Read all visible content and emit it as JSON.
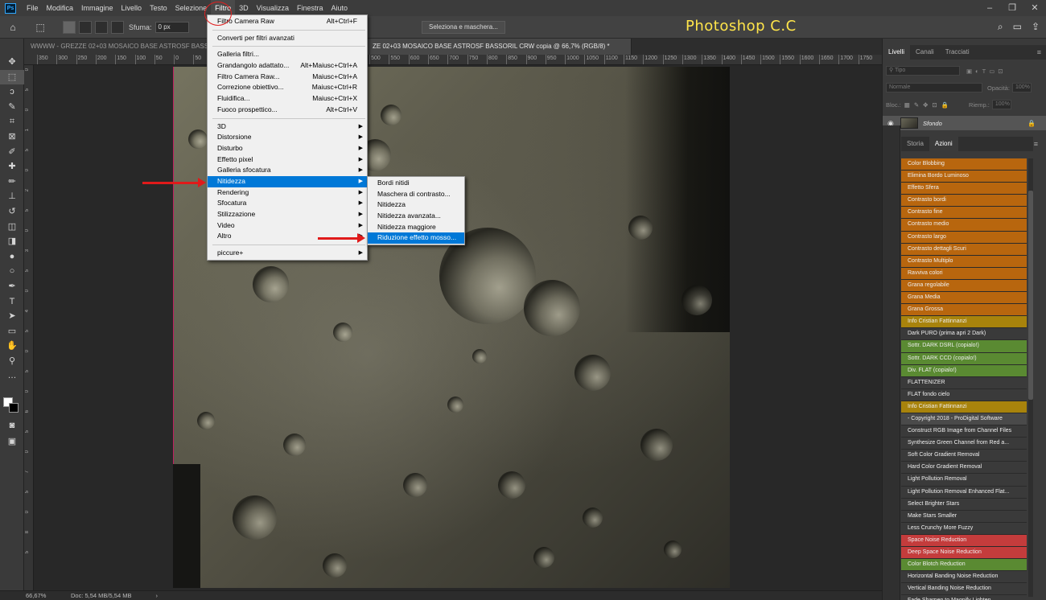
{
  "app": {
    "logo": "Ps",
    "brand_text": "Photoshop C.C"
  },
  "menubar": {
    "items": [
      "File",
      "Modifica",
      "Immagine",
      "Livello",
      "Testo",
      "Selezione",
      "Filtro",
      "3D",
      "Visualizza",
      "Finestra",
      "Aiuto"
    ],
    "active": "Filtro",
    "window_controls": [
      "–",
      "❐",
      "✕"
    ]
  },
  "options_bar": {
    "home_icon": "home-icon",
    "feather_label": "Sfuma:",
    "feather_value": "0 px",
    "select_mask_label": "Seleziona e maschera...",
    "right_icons": [
      "search-icon",
      "workspace-icon",
      "share-icon"
    ]
  },
  "tabs": [
    {
      "label": "WWWW - GREZZE 02+03 MOSAICO BASE ASTROSF BASSORIL",
      "active": false
    },
    {
      "label": "ZE 02+03 MOSAICO BASE ASTROSF BASSORIL CRW copia @ 66,7% (RGB/8) *",
      "active": true
    }
  ],
  "ruler": {
    "top_ticks": [
      "350",
      "300",
      "250",
      "200",
      "150",
      "100",
      "50",
      "0",
      "50",
      "100",
      "150",
      "200",
      "250",
      "300",
      "350",
      "400",
      "450",
      "500",
      "550",
      "600",
      "650",
      "700",
      "750",
      "800",
      "850",
      "900",
      "950",
      "1000",
      "1050",
      "1100",
      "1150",
      "1200",
      "1250",
      "1300",
      "1350",
      "1400",
      "1450",
      "1500",
      "1550",
      "1600",
      "1650",
      "1700",
      "1750"
    ],
    "left_ticks": [
      "0",
      "5",
      "0",
      "1",
      "5",
      "0",
      "2",
      "5",
      "0",
      "3",
      "5",
      "0",
      "4",
      "5",
      "0",
      "5",
      "0",
      "6",
      "5",
      "0",
      "7",
      "5",
      "0",
      "8",
      "5"
    ]
  },
  "filtro_menu": {
    "items": [
      {
        "label": "Filtro Camera Raw",
        "shortcut": "Alt+Ctrl+F"
      },
      {
        "sep": true
      },
      {
        "label": "Converti per filtri avanzati"
      },
      {
        "sep": true
      },
      {
        "label": "Galleria filtri..."
      },
      {
        "label": "Grandangolo adattato...",
        "shortcut": "Alt+Maiusc+Ctrl+A"
      },
      {
        "label": "Filtro Camera Raw...",
        "shortcut": "Maiusc+Ctrl+A"
      },
      {
        "label": "Correzione obiettivo...",
        "shortcut": "Maiusc+Ctrl+R"
      },
      {
        "label": "Fluidifica...",
        "shortcut": "Maiusc+Ctrl+X"
      },
      {
        "label": "Fuoco prospettico...",
        "shortcut": "Alt+Ctrl+V"
      },
      {
        "sep": true
      },
      {
        "label": "3D",
        "submenu": true
      },
      {
        "label": "Distorsione",
        "submenu": true
      },
      {
        "label": "Disturbo",
        "submenu": true
      },
      {
        "label": "Effetto pixel",
        "submenu": true
      },
      {
        "label": "Galleria sfocatura",
        "submenu": true
      },
      {
        "label": "Nitidezza",
        "submenu": true,
        "highlighted": true
      },
      {
        "label": "Rendering",
        "submenu": true
      },
      {
        "label": "Sfocatura",
        "submenu": true
      },
      {
        "label": "Stilizzazione",
        "submenu": true
      },
      {
        "label": "Video",
        "submenu": true
      },
      {
        "label": "Altro",
        "submenu": true
      },
      {
        "sep": true
      },
      {
        "label": "piccure+",
        "submenu": true
      }
    ]
  },
  "nitidezza_submenu": {
    "items": [
      {
        "label": "Bordi nitidi"
      },
      {
        "label": "Maschera di contrasto..."
      },
      {
        "label": "Nitidezza"
      },
      {
        "label": "Nitidezza avanzata..."
      },
      {
        "label": "Nitidezza maggiore"
      },
      {
        "label": "Riduzione effetto mosso...",
        "highlighted": true
      }
    ]
  },
  "layers_panel": {
    "tabs": [
      "Livelli",
      "Canali",
      "Tracciati"
    ],
    "active_tab": "Livelli",
    "filter_placeholder": "Tipo",
    "blend_mode": "Normale",
    "opacity_label": "Opacità:",
    "opacity_value": "100%",
    "lock_label": "Bloc.:",
    "fill_label": "Riemp.:",
    "fill_value": "100%",
    "layer_name": "Sfondo"
  },
  "actions_panel": {
    "tabs": [
      "Storia",
      "Azioni"
    ],
    "active_tab": "Azioni",
    "items": [
      {
        "label": "Color Blobbing",
        "color": "orange"
      },
      {
        "label": "Elimina Bordo Luminoso",
        "color": "orange"
      },
      {
        "label": "Effetto Sfera",
        "color": "orange"
      },
      {
        "label": "Contrasto bordi",
        "color": "orange"
      },
      {
        "label": "Contrasto fine",
        "color": "orange"
      },
      {
        "label": "Contrasto medio",
        "color": "orange"
      },
      {
        "label": "Contrasto largo",
        "color": "orange"
      },
      {
        "label": "Contrasto dettagli Scuri",
        "color": "orange"
      },
      {
        "label": "Contrasto Multiplo",
        "color": "orange"
      },
      {
        "label": "Ravviva colori",
        "color": "orange"
      },
      {
        "label": "Grana regolabile",
        "color": "orange"
      },
      {
        "label": "Grana Media",
        "color": "orange"
      },
      {
        "label": "Grana Grossa",
        "color": "orange"
      },
      {
        "label": "Info Cristian Fattinnanzi",
        "color": "gold"
      },
      {
        "label": "Dark PURO (prima apri 2 Dark)",
        "color": "none"
      },
      {
        "label": "Sottr. DARK DSRL (copialo!)",
        "color": "green"
      },
      {
        "label": "Sottr. DARK CCD (copialo!)",
        "color": "green"
      },
      {
        "label": "Div. FLAT (copialo!)",
        "color": "green"
      },
      {
        "label": "FLATTENIZER",
        "color": "none"
      },
      {
        "label": "FLAT fondo cielo",
        "color": "none"
      },
      {
        "label": "Info Cristian Fattinnanzi",
        "color": "gold"
      },
      {
        "label": "- Copyright 2018 - ProDigital Software",
        "color": "gray"
      },
      {
        "label": "Construct RGB Image from Channel Files",
        "color": "none"
      },
      {
        "label": "Synthesize Green Channel from Red a...",
        "color": "none"
      },
      {
        "label": "Soft Color Gradient Removal",
        "color": "none"
      },
      {
        "label": "Hard Color Gradient Removal",
        "color": "none"
      },
      {
        "label": "Light Pollution Removal",
        "color": "none"
      },
      {
        "label": "Light Pollution Removal Enhanced Flat...",
        "color": "none"
      },
      {
        "label": "Select Brighter Stars",
        "color": "none"
      },
      {
        "label": "Make Stars Smaller",
        "color": "none"
      },
      {
        "label": "Less Crunchy More Fuzzy",
        "color": "none"
      },
      {
        "label": "Space Noise Reduction",
        "color": "red"
      },
      {
        "label": "Deep Space Noise Reduction",
        "color": "red"
      },
      {
        "label": "Color Blotch Reduction",
        "color": "green"
      },
      {
        "label": "Horizontal Banding Noise Reduction",
        "color": "none"
      },
      {
        "label": "Vertical Banding Noise Reduction",
        "color": "none"
      },
      {
        "label": "Fade Sharpen to Magnify Lighten",
        "color": "none"
      }
    ]
  },
  "status_bar": {
    "zoom": "66,67%",
    "doc_info": "Doc: 5,54 MB/5,54 MB",
    "chevron": "›"
  },
  "colors": {
    "menu_highlight": "#0078d7",
    "annotation_red": "#e01a1a",
    "brand_yellow": "#ffe54a"
  }
}
